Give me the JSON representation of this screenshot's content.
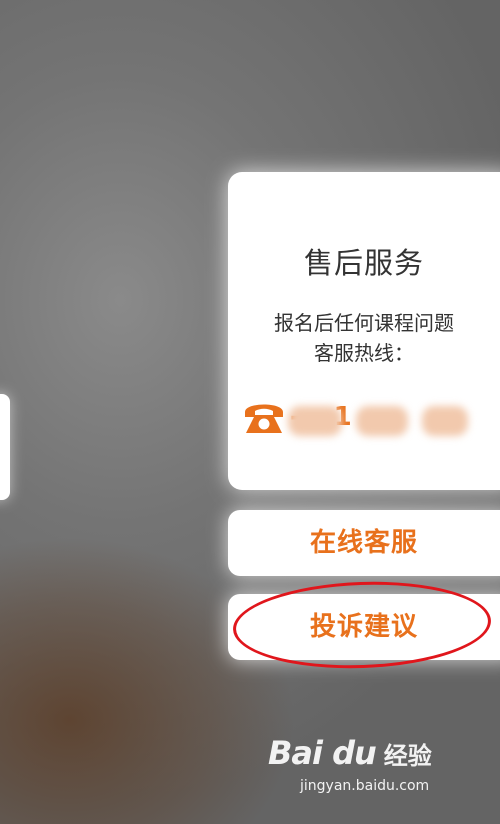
{
  "service_panel": {
    "title": "售后服务",
    "description_line1": "报名后任何课程问题",
    "description_line2": "客服热线：",
    "phone_number_visible": "-  -  1"
  },
  "buttons": {
    "online_service_label": "在线客服",
    "complaint_label": "投诉建议"
  },
  "watermark": {
    "brand": "Bai du",
    "suffix": "经验",
    "url": "jingyan.baidu.com"
  },
  "icons": {
    "phone": "telephone-icon",
    "paw": "baidu-paw-icon"
  },
  "colors": {
    "accent": "#e8711c",
    "highlight": "#e0161c",
    "card": "#ffffff",
    "backdrop": "#6b6b6b"
  }
}
